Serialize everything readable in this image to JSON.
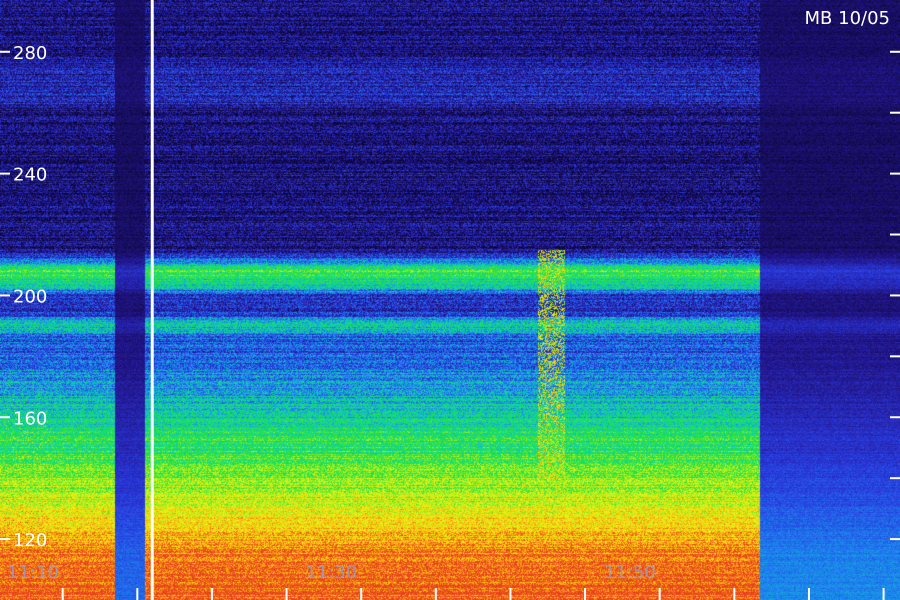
{
  "station_label": "MB 10/05",
  "colors": {
    "background": "#000000",
    "tick": "#ffffff",
    "marker": "#ffffff",
    "colormap": [
      "#0a0630",
      "#22158a",
      "#2a3be0",
      "#1a8cf0",
      "#10d8a0",
      "#20e040",
      "#a8f020",
      "#f8f010",
      "#f8a010",
      "#e84020"
    ]
  },
  "chart_data": {
    "type": "heatmap",
    "title": "",
    "xlabel": "",
    "ylabel": "",
    "x_tick_labels": [
      "11:10",
      "11:30",
      "11:50"
    ],
    "x_tick_values": [
      670,
      690,
      710
    ],
    "x_range": [
      667.8,
      728.1
    ],
    "y_tick_labels": [
      "120",
      "160",
      "200",
      "240",
      "280"
    ],
    "y_tick_values": [
      120,
      160,
      200,
      240,
      280
    ],
    "y_range": [
      100,
      297
    ],
    "marker_time": 678,
    "bands": [
      {
        "freq": 208,
        "width": 4,
        "intensity": 0.45
      },
      {
        "freq": 203,
        "width": 2,
        "intensity": 0.2
      },
      {
        "freq": 190,
        "width": 3,
        "intensity": 0.2
      }
    ],
    "dark_gaps": [
      {
        "x0": 675.5,
        "x1": 677.5,
        "depth": 0.75
      },
      {
        "x0": 718.7,
        "x1": 728.1,
        "depth": 0.7
      }
    ],
    "burst": {
      "x0": 703.8,
      "x1": 705.6,
      "f0": 140,
      "f1": 215,
      "intensity": 0.55
    },
    "grid": false,
    "legend": "none"
  }
}
